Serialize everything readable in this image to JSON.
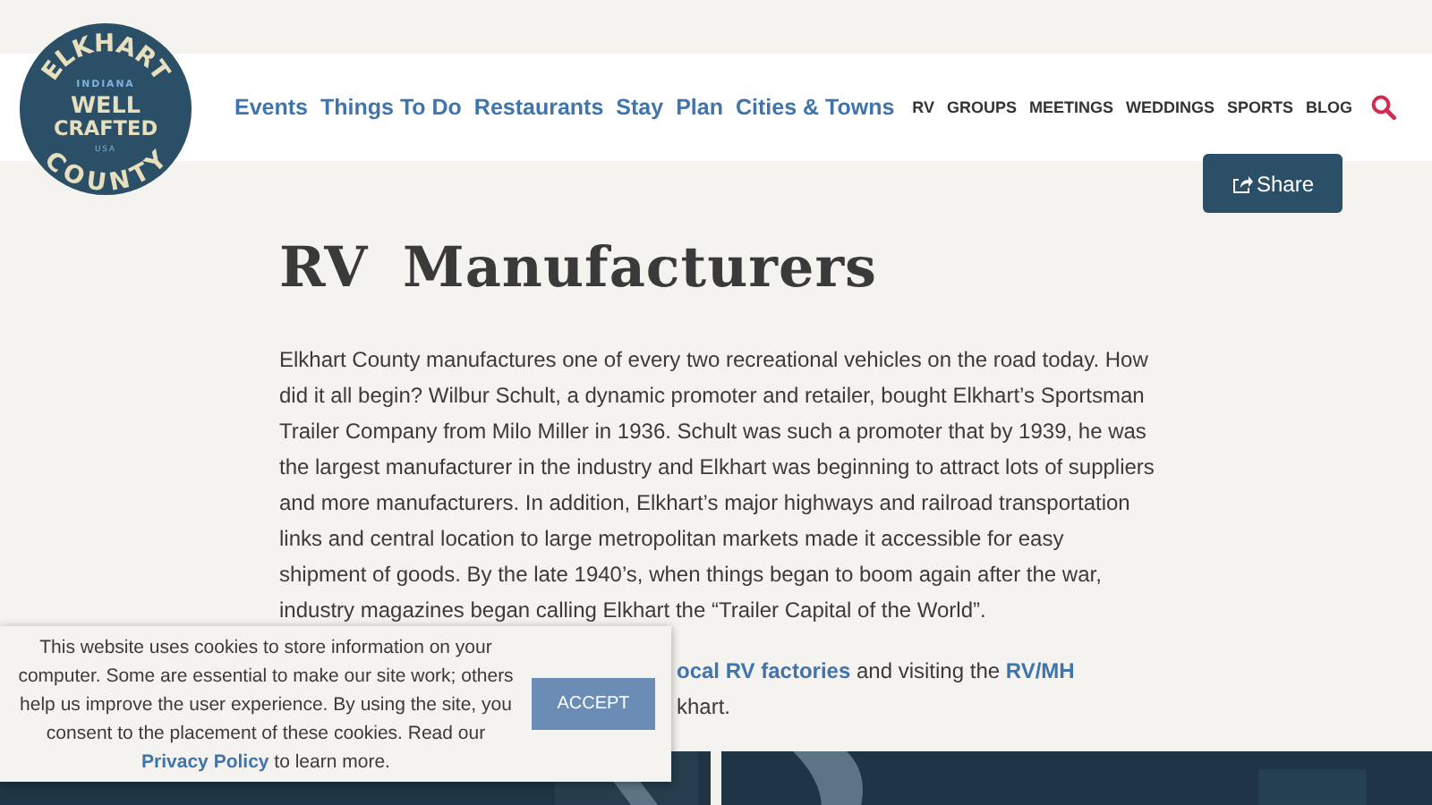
{
  "logo": {
    "top": "ELKHART",
    "state": "INDIANA",
    "line_1": "WELL",
    "line_2": "CRAFTED",
    "country": "USA",
    "bottom": "COUNTY"
  },
  "nav": {
    "primary": [
      "Events",
      "Things To Do",
      "Restaurants",
      "Stay",
      "Plan",
      "Cities & Towns"
    ],
    "secondary": [
      "RV",
      "GROUPS",
      "MEETINGS",
      "WEDDINGS",
      "SPORTS",
      "BLOG"
    ]
  },
  "share_button": "Share",
  "title": "RV Manufacturers",
  "paragraph": "Elkhart County manufactures one of every two recreational vehicles on the road today. How did it all begin? Wilbur Schult, a dynamic promoter and retailer, bought Elkhart’s Sportsman Trailer Company from Milo Miller in 1936. Schult was such a promoter that by 1939, he was the largest manufacturer in the industry and Elkhart was beginning to attract lots of suppliers and more manufacturers. In addition, Elkhart’s major highways and railroad transportation links and central location to large metropolitan markets made it accessible for easy shipment of goods. By the late 1940’s, when things began to boom again after the war, industry magazines began calling Elkhart the “Trailer Capital of the World”.",
  "partial_paragraph": {
    "link_1": "ocal RV factories",
    "text_1": "and visiting the",
    "link_2": "RV/MH",
    "text_2": "khart."
  },
  "cookie_banner": {
    "text_before": "This website uses cookies to store information on your computer. Some are essential to make our site work; others help us improve the user experience. By using the site, you consent to the placement of these cookies. Read our",
    "link": "Privacy Policy",
    "text_after": "to learn more.",
    "button": "ACCEPT"
  }
}
